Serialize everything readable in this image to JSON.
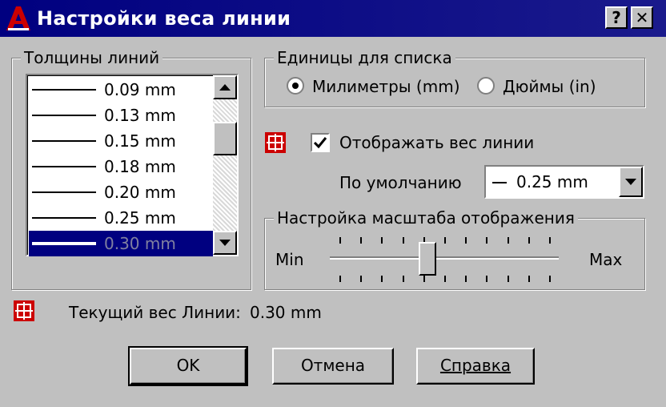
{
  "window": {
    "title": "Настройки веса линии",
    "help_button": "?",
    "close_button": "✕"
  },
  "lineweights": {
    "legend": "Толщины линий",
    "items": [
      "0.09 mm",
      "0.13 mm",
      "0.15 mm",
      "0.18 mm",
      "0.20 mm",
      "0.25 mm",
      "0.30 mm"
    ],
    "selected": "0.30 mm"
  },
  "units": {
    "legend": "Единицы для списка",
    "mm_label": "Милиметры (mm)",
    "in_label": "Дюймы (in)",
    "selected": "mm"
  },
  "display": {
    "checkbox_label": "Отображать вес линии",
    "checked": true,
    "default_label": "По умолчанию",
    "default_value": "0.25 mm"
  },
  "scale": {
    "legend": "Настройка масштаба отображения",
    "min_label": "Min",
    "max_label": "Max",
    "level": 0.42
  },
  "current": {
    "label": "Текущий вес Линии:",
    "value": "0.30 mm"
  },
  "buttons": {
    "ok": "OK",
    "cancel": "Отмена",
    "help": "Справка"
  },
  "colors": {
    "titlebar": "#000080",
    "face": "#c0c0c0",
    "selection": "#000080",
    "icon_red": "#cc0000"
  }
}
